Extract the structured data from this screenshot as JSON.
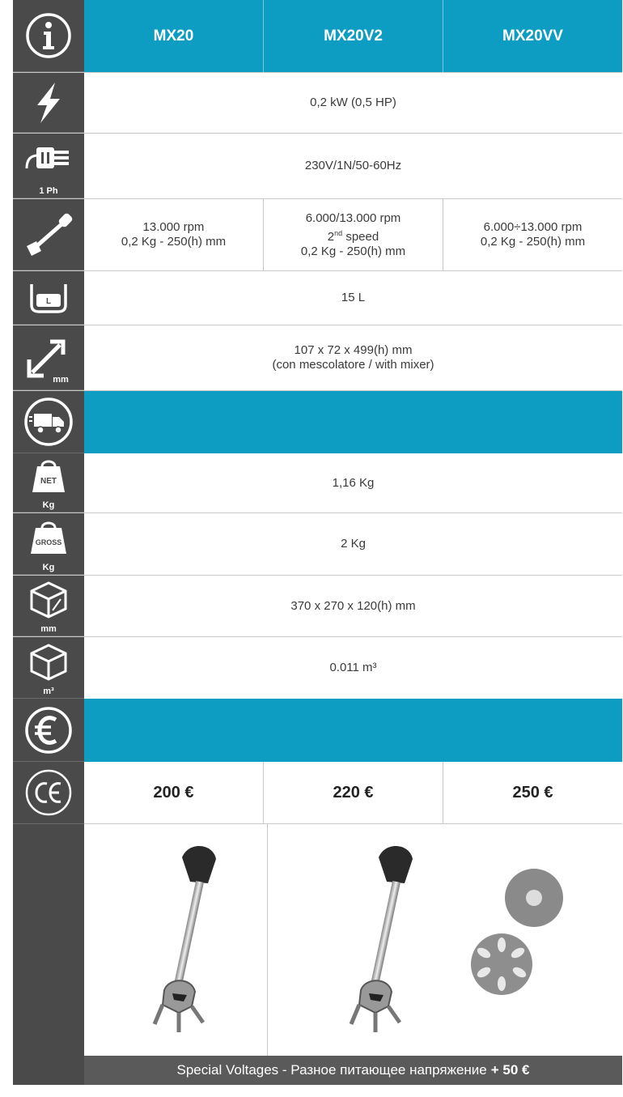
{
  "header": {
    "models": [
      "MX20",
      "MX20V2",
      "MX20VV"
    ]
  },
  "specs": {
    "power": "0,2 kW (0,5 HP)",
    "voltage": "230V/1N/50-60Hz",
    "voltage_icon_label": "1 Ph",
    "speed": [
      {
        "line1": "13.000 rpm",
        "line3": "0,2 Kg - 250(h) mm"
      },
      {
        "line1": "6.000/13.000 rpm",
        "line2_num": "2",
        "line2_sup": "nd",
        "line2_text": " speed",
        "line3": "0,2 Kg - 250(h) mm"
      },
      {
        "line1": "6.000÷13.000 rpm",
        "line3": "0,2 Kg - 250(h) mm"
      }
    ],
    "capacity": "15 L",
    "capacity_icon_label": "L",
    "dimensions_line1": "107 x 72 x 499(h) mm",
    "dimensions_line2": "(con mescolatore / with mixer)",
    "dimensions_icon_label": "mm"
  },
  "shipping": {
    "net_weight": "1,16 Kg",
    "net_icon_top": "NET",
    "net_icon_label": "Kg",
    "gross_weight": "2 Kg",
    "gross_icon_top": "GROSS",
    "gross_icon_label": "Kg",
    "package_dimensions": "370 x 270 x 120(h) mm",
    "package_icon_label": "mm",
    "volume": "0.011 m³",
    "volume_icon_label": "m³"
  },
  "prices": [
    "200 €",
    "220 €",
    "250 €"
  ],
  "footer": {
    "text": "Special Voltages - Разное питающее напряжение",
    "surcharge": "+ 50 €"
  },
  "colors": {
    "accent": "#0e9dc2",
    "icon_bg": "#4a4a4a",
    "footer_bg": "#5a5a5a"
  }
}
